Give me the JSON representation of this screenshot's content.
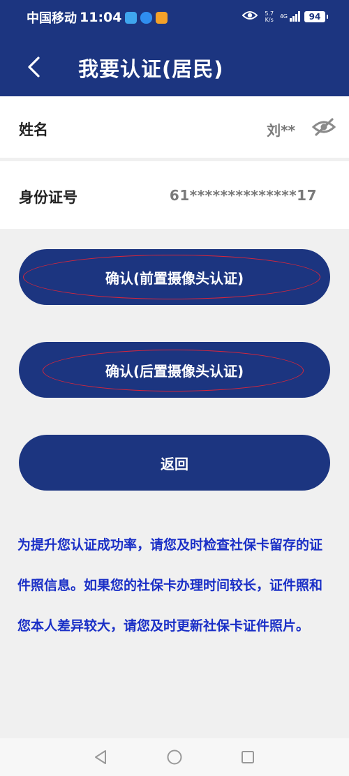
{
  "status_bar": {
    "carrier": "中国移动",
    "time": "11:04",
    "net_speed_value": "5.7",
    "net_speed_unit": "K/s",
    "network": "4G",
    "battery": "94"
  },
  "header": {
    "title": "我要认证(居民)"
  },
  "form": {
    "name_label": "姓名",
    "name_value": "刘**",
    "id_label": "身份证号",
    "id_value": "61**************17"
  },
  "buttons": {
    "front_camera": "确认(前置摄像头认证)",
    "rear_camera": "确认(后置摄像头认证)",
    "back": "返回"
  },
  "notice": {
    "text": "为提升您认证成功率，请您及时检查社保卡留存的证件照信息。如果您的社保卡办理时间较长，证件照和您本人差异较大，请您及时更新社保卡证件照片。"
  },
  "colors": {
    "primary": "#1c3580",
    "notice_text": "#1a2fc6",
    "annotation": "#d9263a",
    "background": "#f0f0f0"
  }
}
